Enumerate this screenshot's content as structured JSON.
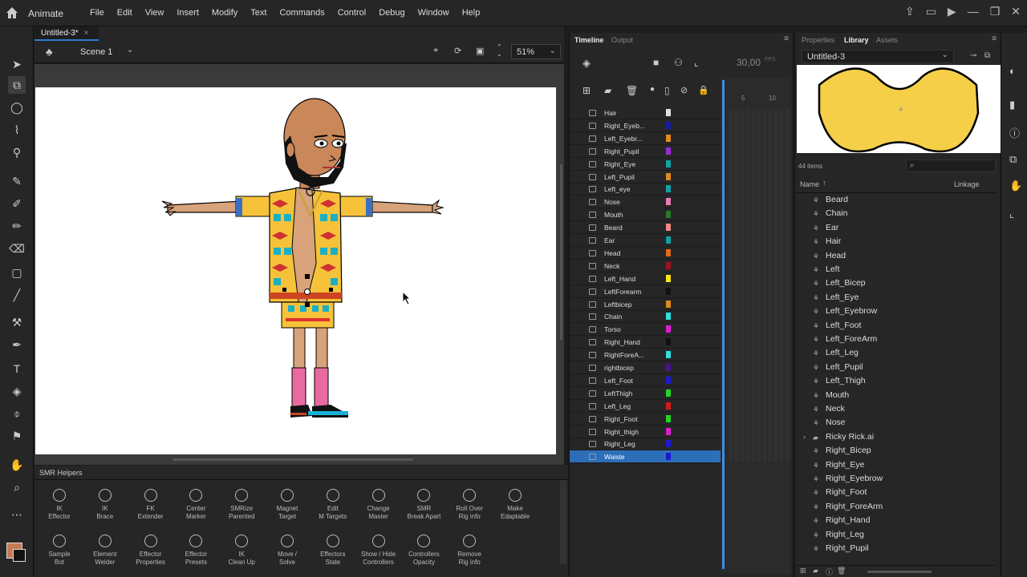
{
  "app": {
    "title": "Animate"
  },
  "menu": [
    "File",
    "Edit",
    "View",
    "Insert",
    "Modify",
    "Text",
    "Commands",
    "Control",
    "Debug",
    "Window",
    "Help"
  ],
  "document": {
    "tab": "Untitled-3*",
    "scene": "Scene 1",
    "zoom": "51%"
  },
  "panels": {
    "timeline": "Timeline",
    "output": "Output",
    "properties": "Properties",
    "library": "Library",
    "assets": "Assets",
    "smr": "SMR Helpers"
  },
  "timeline": {
    "fps": "30,00",
    "fps_unit": "FPS",
    "frame_marks": [
      "5",
      "10"
    ],
    "layers": [
      {
        "name": "Hair",
        "color": "#e0e0e0"
      },
      {
        "name": "Right_Eyeb...",
        "color": "#1a1aa8"
      },
      {
        "name": "Left_Eyebr...",
        "color": "#e08a1e"
      },
      {
        "name": "Right_Pupil",
        "color": "#9a2bd6"
      },
      {
        "name": "Right_Eye",
        "color": "#11a3a3"
      },
      {
        "name": "Left_Pupil",
        "color": "#e08a1e"
      },
      {
        "name": "Left_eye",
        "color": "#11a3a3"
      },
      {
        "name": "Nose",
        "color": "#e87ab8"
      },
      {
        "name": "Mouth",
        "color": "#2b7a2b"
      },
      {
        "name": "Beard",
        "color": "#f08888"
      },
      {
        "name": "Ear",
        "color": "#11a3a3"
      },
      {
        "name": "Head",
        "color": "#e06a1e"
      },
      {
        "name": "Neck",
        "color": "#a0141c"
      },
      {
        "name": "Left_Hand",
        "color": "#f5e614"
      },
      {
        "name": "LeftForearm",
        "color": "#111111"
      },
      {
        "name": "Leftbicep",
        "color": "#e08a1e"
      },
      {
        "name": "Chain",
        "color": "#2ee0e0"
      },
      {
        "name": "Torso",
        "color": "#e01ad6"
      },
      {
        "name": "Right_Hand",
        "color": "#111111"
      },
      {
        "name": "RightForeA...",
        "color": "#2ee0e0"
      },
      {
        "name": "rightbicep",
        "color": "#4a148c"
      },
      {
        "name": "Left_Foot",
        "color": "#1a1ad6"
      },
      {
        "name": "LeftThigh",
        "color": "#22d622"
      },
      {
        "name": "Left_Leg",
        "color": "#d61a1a"
      },
      {
        "name": "Right_Foot",
        "color": "#22d622"
      },
      {
        "name": "Right_thigh",
        "color": "#e01ad6"
      },
      {
        "name": "Right_Leg",
        "color": "#1a1ad6"
      },
      {
        "name": "Waiste",
        "color": "#1a1ad6"
      }
    ],
    "selected": "Waiste"
  },
  "library": {
    "doc": "Untitled-3",
    "count": "44 items",
    "col_name": "Name",
    "col_linkage": "Linkage",
    "items": [
      "Beard",
      "Chain",
      "Ear",
      "Hair",
      "Head",
      "Left",
      "Left_Bicep",
      "Left_Eye",
      "Left_Eyebrow",
      "Left_Foot",
      "Left_ForeArm",
      "Left_Leg",
      "Left_Pupil",
      "Left_Thigh",
      "Mouth",
      "Neck",
      "Nose",
      "Ricky Rick.ai",
      "Right_Bicep",
      "Right_Eye",
      "Right_Eyebrow",
      "Right_Foot",
      "Right_ForeArm",
      "Right_Hand",
      "Right_Leg",
      "Right_Pupil"
    ],
    "folder": "Ricky Rick.ai"
  },
  "smr": {
    "row1": [
      {
        "l1": "IK",
        "l2": "Effector"
      },
      {
        "l1": "IK",
        "l2": "Brace"
      },
      {
        "l1": "FK",
        "l2": "Extender"
      },
      {
        "l1": "Center",
        "l2": "Marker"
      },
      {
        "l1": "SMRize",
        "l2": "Parented"
      },
      {
        "l1": "Magnet",
        "l2": "Target"
      },
      {
        "l1": "Edit",
        "l2": "M Targets"
      },
      {
        "l1": "Change",
        "l2": "Master"
      },
      {
        "l1": "SMR",
        "l2": "Break Apart"
      },
      {
        "l1": "Roll Over",
        "l2": "Rig info"
      },
      {
        "l1": "Make",
        "l2": "Edaptable"
      }
    ],
    "row2": [
      {
        "l1": "Sample",
        "l2": "Bot"
      },
      {
        "l1": "Element",
        "l2": "Welder"
      },
      {
        "l1": "Effector",
        "l2": "Properties"
      },
      {
        "l1": "Effector",
        "l2": "Presets"
      },
      {
        "l1": "IK",
        "l2": "Clean Up"
      },
      {
        "l1": "Move /",
        "l2": "Solve"
      },
      {
        "l1": "Effectors",
        "l2": "State"
      },
      {
        "l1": "Show / Hide",
        "l2": "Controllers"
      },
      {
        "l1": "Controllers",
        "l2": "Opacity"
      },
      {
        "l1": "Remove",
        "l2": "Rig info"
      }
    ]
  }
}
